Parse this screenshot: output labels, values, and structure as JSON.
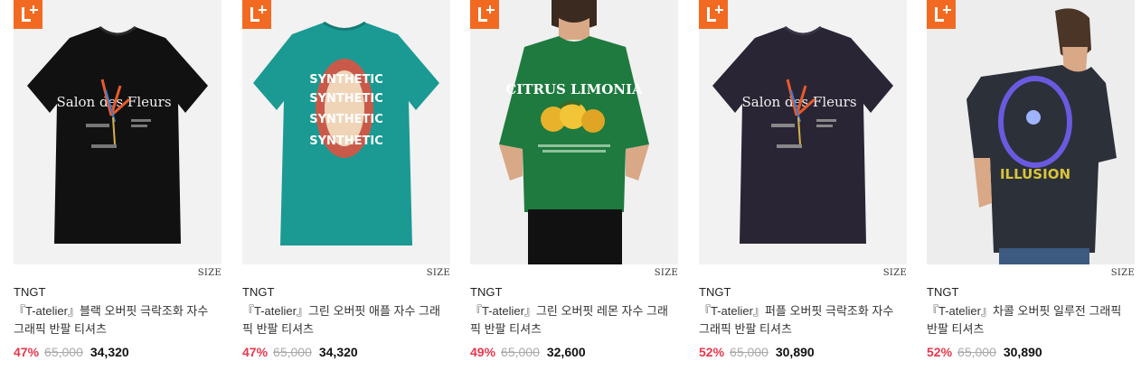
{
  "products": [
    {
      "brand": "TNGT",
      "name": "『T-atelier』블랙 오버핏 극락조화 자수 그래픽 반팔 티셔츠",
      "discount": "47%",
      "original_price": "65,000",
      "sale_price": "34,320",
      "size_label": "SIZE",
      "badge_icon": "l-plus-badge-icon",
      "badge_color": "#f26a21",
      "shirt_color": "#111111",
      "print_text": "Salon des Fleurs"
    },
    {
      "brand": "TNGT",
      "name": "『T-atelier』그린 오버핏 애플 자수 그래픽 반팔 티셔츠",
      "discount": "47%",
      "original_price": "65,000",
      "sale_price": "34,320",
      "size_label": "SIZE",
      "badge_icon": "l-plus-badge-icon",
      "badge_color": "#f26a21",
      "shirt_color": "#1a9a93",
      "print_text": "SYNTHETIC"
    },
    {
      "brand": "TNGT",
      "name": "『T-atelier』그린 오버핏 레몬 자수 그래픽 반팔 티셔츠",
      "discount": "49%",
      "original_price": "65,000",
      "sale_price": "32,600",
      "size_label": "SIZE",
      "badge_icon": "l-plus-badge-icon",
      "badge_color": "#f26a21",
      "shirt_color": "#1e7a3e",
      "print_text": "CITRUS LIMONIA"
    },
    {
      "brand": "TNGT",
      "name": "『T-atelier』퍼플 오버핏 극락조화 자수 그래픽 반팔 티셔츠",
      "discount": "52%",
      "original_price": "65,000",
      "sale_price": "30,890",
      "size_label": "SIZE",
      "badge_icon": "l-plus-badge-icon",
      "badge_color": "#f26a21",
      "shirt_color": "#2a2535",
      "print_text": "Salon des Fleurs"
    },
    {
      "brand": "TNGT",
      "name": "『T-atelier』차콜 오버핏 일루전 그래픽 반팔 티셔츠",
      "discount": "52%",
      "original_price": "65,000",
      "sale_price": "30,890",
      "size_label": "SIZE",
      "badge_icon": "l-plus-badge-icon",
      "badge_color": "#f26a21",
      "shirt_color": "#2c3039",
      "print_text": "ILLUSION"
    }
  ]
}
